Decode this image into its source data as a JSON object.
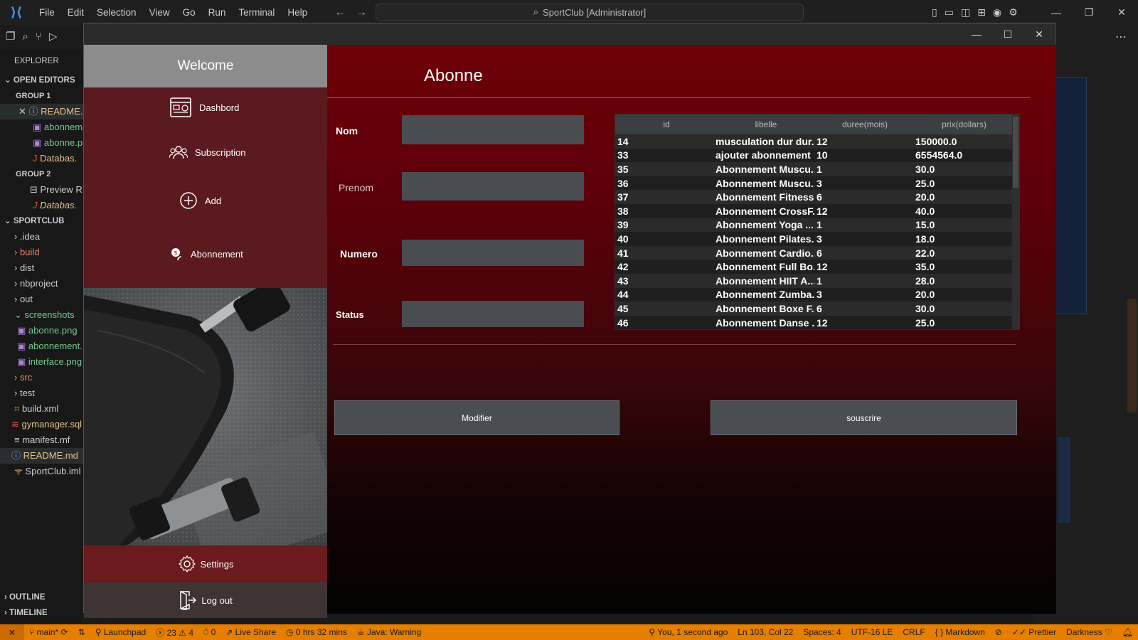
{
  "vscode": {
    "menu": [
      "File",
      "Edit",
      "Selection",
      "View",
      "Go",
      "Run",
      "Terminal",
      "Help"
    ],
    "command_center": "SportClub [Administrator]",
    "explorer": {
      "title": "EXPLORER",
      "open_editors": "OPEN EDITORS",
      "group1": "GROUP 1",
      "group1_files": [
        "README.",
        "abonnem",
        "abonne.p",
        "Databas."
      ],
      "group2": "GROUP 2",
      "group2_files": [
        "Preview R",
        "Databas."
      ],
      "project": "SPORTCLUB",
      "tree": [
        ".idea",
        "build",
        "dist",
        "nbproject",
        "out",
        "screenshots",
        "abonne.png",
        "abonnement.",
        "interface.png",
        "src",
        "test",
        "build.xml",
        "gymanager.sql",
        "manifest.mf",
        "README.md",
        "SportClub.iml"
      ],
      "outline": "OUTLINE",
      "timeline": "TIMELINE"
    },
    "statusbar": {
      "branch": "main*",
      "launchpad": "Launchpad",
      "errors": "23",
      "warnings": "4",
      "info": "0",
      "live_share": "Live Share",
      "time": "0 hrs 32 mins",
      "java": "Java: Warning",
      "blame": "You, 1 second ago",
      "position": "Ln 103, Col 22",
      "spaces": "Spaces: 4",
      "encoding": "UTF-16 LE",
      "eol": "CRLF",
      "language": "Markdown",
      "prettier": "Prettier",
      "theme": "Darkness"
    }
  },
  "app": {
    "sidebar": {
      "welcome": "Welcome",
      "dashboard": "Dashbord",
      "subscription": "Subscription",
      "add": "Add",
      "abonnement": "Abonnement",
      "settings": "Settings",
      "logout": "Log out"
    },
    "main": {
      "title": "Abonne",
      "labels": {
        "nom": "Nom",
        "prenom": "Prenom",
        "numero": "Numero",
        "status": "Status"
      },
      "inputs": {
        "nom": "",
        "prenom": "",
        "numero": "",
        "status": ""
      },
      "buttons": {
        "modifier": "Modifier",
        "souscrire": "souscrire"
      },
      "table": {
        "columns": [
          "id",
          "libelle",
          "duree(mois)",
          "prix(dollars)"
        ],
        "rows": [
          [
            "14",
            "musculation dur dur...",
            "12",
            "150000.0"
          ],
          [
            "33",
            "ajouter abonnement",
            "10",
            "6554564.0"
          ],
          [
            "35",
            "Abonnement Muscu...",
            "1",
            "30.0"
          ],
          [
            "36",
            "Abonnement Muscu...",
            "3",
            "25.0"
          ],
          [
            "37",
            "Abonnement Fitness...",
            "6",
            "20.0"
          ],
          [
            "38",
            "Abonnement CrossF...",
            "12",
            "40.0"
          ],
          [
            "39",
            "Abonnement Yoga ...",
            "1",
            "15.0"
          ],
          [
            "40",
            "Abonnement Pilates...",
            "3",
            "18.0"
          ],
          [
            "41",
            "Abonnement Cardio...",
            "6",
            "22.0"
          ],
          [
            "42",
            "Abonnement Full Bo...",
            "12",
            "35.0"
          ],
          [
            "43",
            "Abonnement HIIT A...",
            "1",
            "28.0"
          ],
          [
            "44",
            "Abonnement Zumba...",
            "3",
            "20.0"
          ],
          [
            "45",
            "Abonnement Boxe F...",
            "6",
            "30.0"
          ],
          [
            "46",
            "Abonnement Danse ...",
            "12",
            "25.0"
          ]
        ]
      }
    }
  }
}
